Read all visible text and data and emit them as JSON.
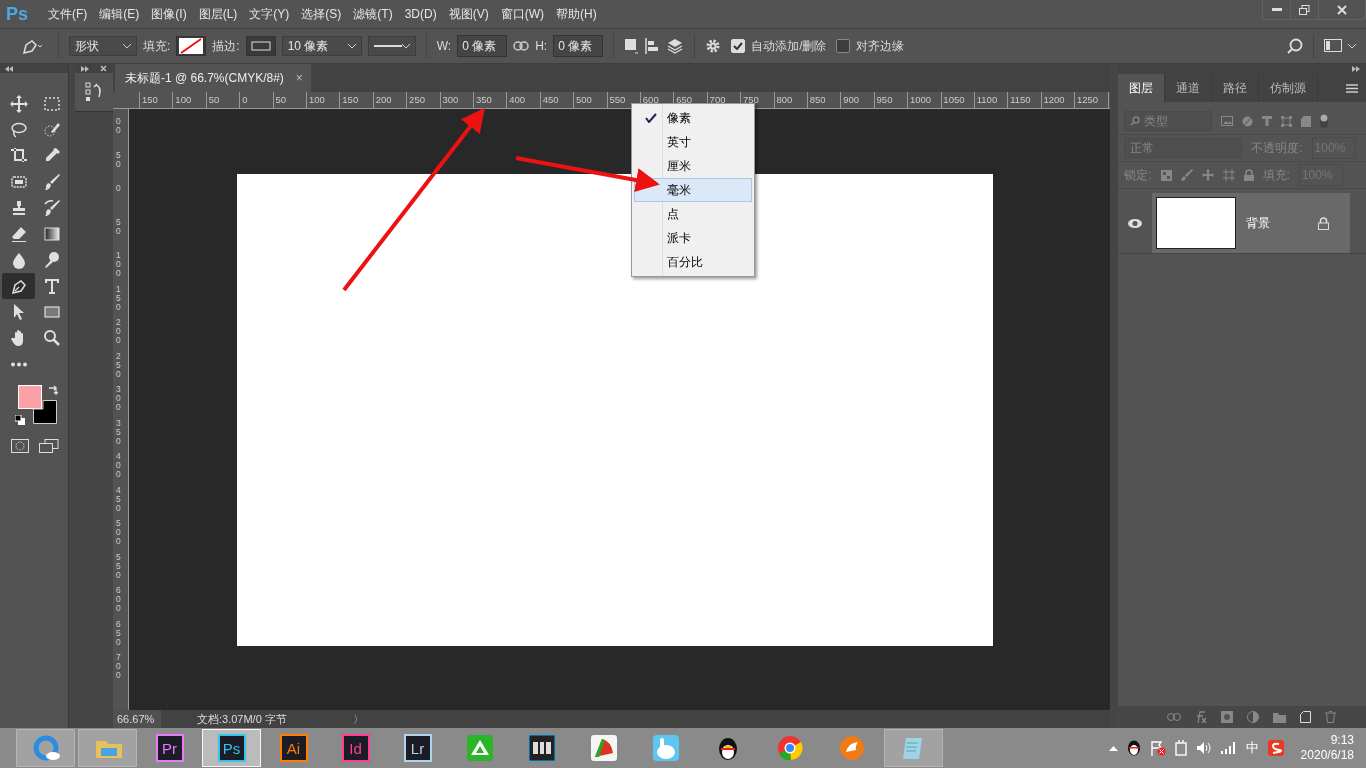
{
  "menu_bar": {
    "logo": "Ps",
    "items": [
      "文件(F)",
      "编辑(E)",
      "图像(I)",
      "图层(L)",
      "文字(Y)",
      "选择(S)",
      "滤镜(T)",
      "3D(D)",
      "视图(V)",
      "窗口(W)",
      "帮助(H)"
    ]
  },
  "options_bar": {
    "tool_mode": "形状",
    "fill_label": "填充:",
    "stroke_label": "描边:",
    "stroke_width": "10 像素",
    "w_label": "W:",
    "w_value": "0 像素",
    "h_label": "H:",
    "h_value": "0 像素",
    "checkboxes": [
      {
        "label": "自动添加/删除",
        "checked": true
      },
      {
        "label": "对齐边缘",
        "checked": false
      }
    ]
  },
  "tools": [
    {
      "kind": "move",
      "selected": false
    },
    {
      "kind": "marquee",
      "selected": false
    },
    {
      "kind": "lasso",
      "selected": false
    },
    {
      "kind": "quickselect",
      "selected": false
    },
    {
      "kind": "crop",
      "selected": false
    },
    {
      "kind": "eyedropper",
      "selected": false
    },
    {
      "kind": "patch",
      "selected": false
    },
    {
      "kind": "brush",
      "selected": false
    },
    {
      "kind": "stamp",
      "selected": false
    },
    {
      "kind": "historybrush",
      "selected": false
    },
    {
      "kind": "eraser",
      "selected": false
    },
    {
      "kind": "gradient",
      "selected": false
    },
    {
      "kind": "drop",
      "selected": false
    },
    {
      "kind": "dodge",
      "selected": false
    },
    {
      "kind": "pen",
      "selected": true
    },
    {
      "kind": "type",
      "selected": false
    },
    {
      "kind": "pathselect",
      "selected": false
    },
    {
      "kind": "rectangle",
      "selected": false
    },
    {
      "kind": "hand",
      "selected": false
    },
    {
      "kind": "zoom",
      "selected": false
    },
    {
      "kind": "more",
      "selected": false
    }
  ],
  "color_swatches": [
    {
      "kind": "foreground",
      "color": "#f9a1a4"
    },
    {
      "kind": "background",
      "color": "#000000"
    }
  ],
  "document_tab": {
    "title": "未标题-1 @ 66.7%(CMYK/8#)",
    "close": "×"
  },
  "ruler": {
    "horizontal": [
      "150",
      "100",
      "50",
      "0",
      "50",
      "100",
      "150",
      "200",
      "250",
      "300",
      "350",
      "400",
      "450",
      "500",
      "550",
      "600",
      "650",
      "700",
      "750",
      "800",
      "850",
      "900",
      "950",
      "1000",
      "1050",
      "1100",
      "1150",
      "1200",
      "1250"
    ],
    "vertical": [
      "00",
      "50",
      "0",
      "50",
      "100",
      "150",
      "200",
      "250",
      "300",
      "350",
      "400",
      "450",
      "500",
      "550",
      "600",
      "650",
      "700"
    ]
  },
  "unit_menu": [
    {
      "label": "像素",
      "checked": true,
      "highlighted": false
    },
    {
      "label": "英寸",
      "checked": false,
      "highlighted": false
    },
    {
      "label": "厘米",
      "checked": false,
      "highlighted": false
    },
    {
      "label": "毫米",
      "checked": false,
      "highlighted": true
    },
    {
      "label": "点",
      "checked": false,
      "highlighted": false
    },
    {
      "label": "派卡",
      "checked": false,
      "highlighted": false
    },
    {
      "label": "百分比",
      "checked": false,
      "highlighted": false
    }
  ],
  "status_bar": {
    "zoom": "66.67%",
    "doc_info": "文档:3.07M/0 字节",
    "arrow": "〉"
  },
  "layers_panel": {
    "tabs": [
      {
        "label": "图层",
        "selected": true
      },
      {
        "label": "通道",
        "selected": false
      },
      {
        "label": "路径",
        "selected": false
      },
      {
        "label": "仿制源",
        "selected": false
      }
    ],
    "filter": "类型",
    "blend_mode": "正常",
    "opacity_label": "不透明度:",
    "opacity": "100%",
    "lock_label": "锁定:",
    "fill_label": "填充:",
    "fill": "100%",
    "layers": [
      {
        "name": "背景",
        "visible": true,
        "locked": true,
        "selected": true
      }
    ]
  },
  "taskbar": {
    "apps": [
      {
        "kind": "player",
        "running": true,
        "selected": false
      },
      {
        "kind": "folder",
        "running": true,
        "selected": false
      },
      {
        "kind": "adobe",
        "label": "Pr",
        "color": "#e77cfb",
        "running": false,
        "selected": false
      },
      {
        "kind": "adobe",
        "label": "Ps",
        "color": "#31c5f0",
        "running": true,
        "selected": true
      },
      {
        "kind": "adobe",
        "label": "Ai",
        "color": "#ff7c00",
        "running": false,
        "selected": false
      },
      {
        "kind": "adobe",
        "label": "Id",
        "color": "#ff3d93",
        "running": false,
        "selected": false
      },
      {
        "kind": "adobe",
        "label": "Lr",
        "color": "#add5ec",
        "running": false,
        "selected": false
      },
      {
        "kind": "greenapp",
        "running": false,
        "selected": false
      },
      {
        "kind": "film",
        "running": false,
        "selected": false
      },
      {
        "kind": "chartapp",
        "running": false,
        "selected": false
      },
      {
        "kind": "rabbit",
        "running": false,
        "selected": false
      },
      {
        "kind": "penguin",
        "running": false,
        "selected": false
      },
      {
        "kind": "chrome",
        "running": false,
        "selected": false
      },
      {
        "kind": "orangeapp",
        "running": false,
        "selected": false
      },
      {
        "kind": "notepad",
        "running": true,
        "selected": false
      }
    ],
    "tray": {
      "ime": "中",
      "time": "9:13",
      "date": "2020/6/18"
    }
  }
}
